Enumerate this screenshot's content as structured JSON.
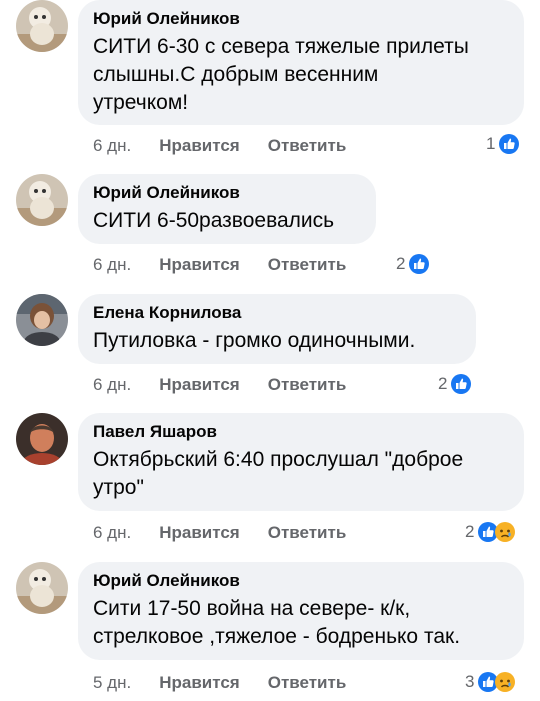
{
  "colors": {
    "bubble_bg": "#f0f2f5",
    "meta_text": "#65676b",
    "like_blue": "#1877f2",
    "sad_yellow": "#f7b125"
  },
  "comments": [
    {
      "author": "Юрий Олейников",
      "text": "СИТИ 6-30 с севера тяжелые прилеты\nслышны.С добрым весенним\nутречком!",
      "time": "6 дн.",
      "like_label": "Нравится",
      "reply_label": "Ответить",
      "reaction_count": "1",
      "reactions": [
        "like-icon"
      ]
    },
    {
      "author": "Юрий Олейников",
      "text": "СИТИ 6-50развоевались",
      "time": "6 дн.",
      "like_label": "Нравится",
      "reply_label": "Ответить",
      "reaction_count": "2",
      "reactions": [
        "like-icon"
      ]
    },
    {
      "author": "Елена Корнилова",
      "text": "Путиловка - громко одиночными.",
      "time": "6 дн.",
      "like_label": "Нравится",
      "reply_label": "Ответить",
      "reaction_count": "2",
      "reactions": [
        "like-icon"
      ]
    },
    {
      "author": "Павел Яшаров",
      "text": "Октябрьский 6:40 прослушал \"доброе\nутро\"",
      "time": "6 дн.",
      "like_label": "Нравится",
      "reply_label": "Ответить",
      "reaction_count": "2",
      "reactions": [
        "like-icon",
        "sad-icon"
      ]
    },
    {
      "author": "Юрий Олейников",
      "text": "Сити 17-50 война на севере- к/к,\nстрелковое ,тяжелое - бодренько так.",
      "time": "5 дн.",
      "like_label": "Нравится",
      "reply_label": "Ответить",
      "reaction_count": "3",
      "reactions": [
        "like-icon",
        "sad-icon"
      ]
    }
  ]
}
